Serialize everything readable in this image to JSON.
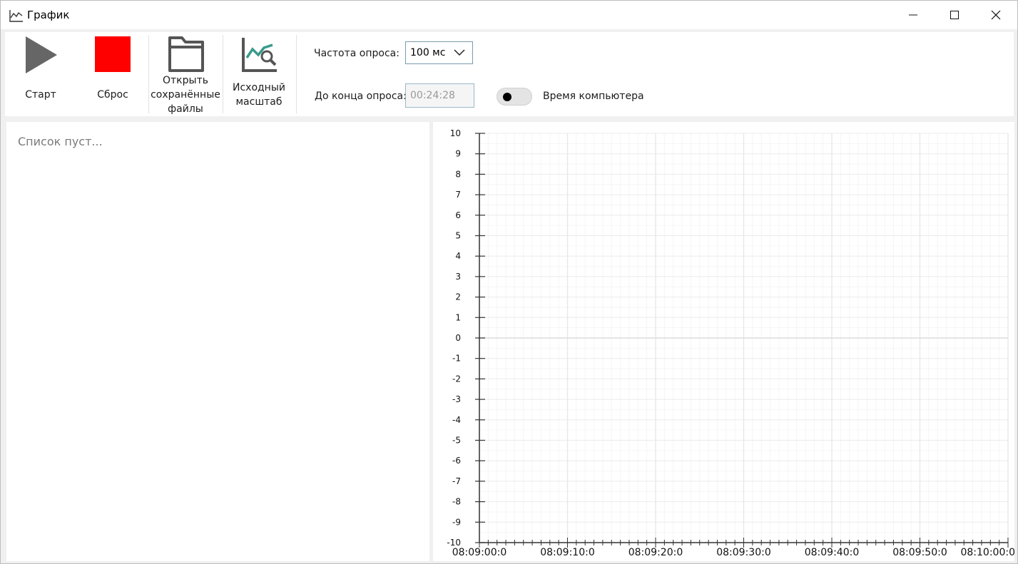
{
  "window": {
    "title": "График",
    "controls": {
      "minimize_icon": "minimize-icon",
      "maximize_icon": "maximize-icon",
      "close_icon": "close-icon"
    }
  },
  "toolbar": {
    "start_label": "Старт",
    "reset_label": "Сброс",
    "open_saved_label_lines": [
      "Открыть",
      "сохранённые",
      "файлы"
    ],
    "reset_zoom_label_lines": [
      "Исходный",
      "масштаб"
    ],
    "poll_rate_label": "Частота опроса:",
    "poll_rate_value": "100 мс",
    "remaining_label": "До конца опроса:",
    "remaining_value": "00:24:28",
    "pc_time_label": "Время компьютера",
    "pc_time_on": false,
    "colors": {
      "start_icon": "#666666",
      "reset_icon": "#ff0000",
      "folder_icon": "#555555",
      "zoom_icon_accent": "#3a9a8c"
    }
  },
  "list_panel": {
    "empty_text": "Список пуст..."
  },
  "chart_data": {
    "type": "line",
    "series": [],
    "ylim": [
      -10,
      10
    ],
    "yticks": [
      "10",
      "9",
      "8",
      "7",
      "6",
      "5",
      "4",
      "3",
      "2",
      "1",
      "0",
      "-1",
      "-2",
      "-3",
      "-4",
      "-5",
      "-6",
      "-7",
      "-8",
      "-9",
      "-10"
    ],
    "xticks": [
      "08:09:00:0",
      "08:09:10:0",
      "08:09:20:0",
      "08:09:30:0",
      "08:09:40:0",
      "08:09:50:0",
      "08:10:00:0"
    ],
    "grid": true
  }
}
